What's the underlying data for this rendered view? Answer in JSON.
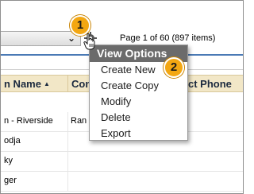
{
  "toolbar": {
    "select_value": "",
    "chevron_icon": "chevron-down-icon",
    "gear_icon": "gear-icon",
    "pager": "Page 1 of 60 (897 items)"
  },
  "grid": {
    "columns": [
      "n Name",
      "Con",
      "ct Phone"
    ],
    "sort_indicator": "▲",
    "rows": [
      {
        "name": "n - Riverside",
        "contact": "Ran"
      },
      {
        "name": "odja",
        "contact": ""
      },
      {
        "name": "ky",
        "contact": ""
      },
      {
        "name": "ger",
        "contact": ""
      }
    ]
  },
  "menu": {
    "title": "View Options",
    "items": [
      "Create New",
      "Create Copy",
      "Modify",
      "Delete",
      "Export"
    ]
  },
  "callouts": [
    "1",
    "2"
  ],
  "colors": {
    "header_bg": "#f2e7c7",
    "menu_title_bg": "#6b6b6b",
    "callout": "#f3a712",
    "rule": "#4a7ab5"
  }
}
